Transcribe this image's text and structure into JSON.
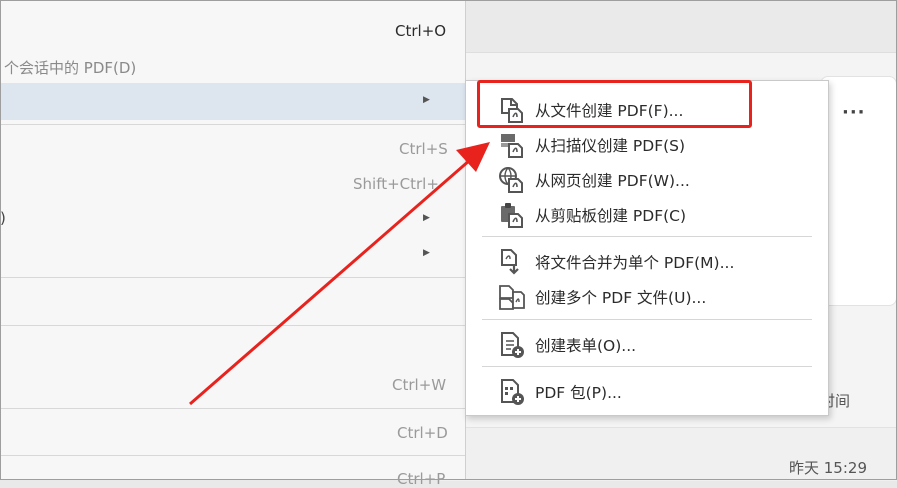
{
  "main_menu": {
    "items": [
      {
        "label": "",
        "shortcut": "Ctrl+O"
      },
      {
        "label": "个会话中的 PDF(D)",
        "shortcut": ""
      },
      {
        "label": "",
        "has_submenu": true,
        "highlighted": true
      },
      {
        "label": "",
        "shortcut": "Ctrl+S"
      },
      {
        "label": "",
        "shortcut": "Shift+Ctrl+"
      },
      {
        "label": ")",
        "has_submenu": true
      },
      {
        "label": "",
        "has_submenu": true
      },
      {
        "label": "",
        "shortcut": "Ctrl+W"
      },
      {
        "label": "",
        "shortcut": "Ctrl+D"
      },
      {
        "label": "",
        "shortcut": "Ctrl+P"
      }
    ]
  },
  "submenu": {
    "items": [
      {
        "label": "从文件创建 PDF(F)...",
        "icon": "create-from-file-icon",
        "highlighted": true
      },
      {
        "label": "从扫描仪创建 PDF(S)",
        "icon": "scanner-icon"
      },
      {
        "label": "从网页创建 PDF(W)...",
        "icon": "web-page-icon"
      },
      {
        "label": "从剪贴板创建 PDF(C)",
        "icon": "clipboard-icon"
      },
      {
        "label": "将文件合并为单个 PDF(M)...",
        "icon": "combine-files-icon"
      },
      {
        "label": "创建多个 PDF 文件(U)...",
        "icon": "multiple-files-icon"
      },
      {
        "label": "创建表单(O)...",
        "icon": "form-icon"
      },
      {
        "label": "PDF 包(P)...",
        "icon": "portfolio-icon"
      }
    ]
  },
  "background": {
    "more_label": "···",
    "column_header": "时间",
    "date_label": "昨天 15:29"
  },
  "annotation": {
    "color": "#e8231e"
  }
}
